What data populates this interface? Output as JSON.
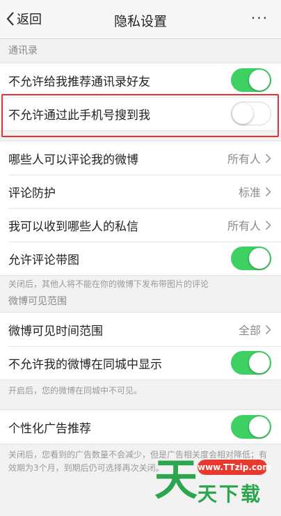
{
  "topbar": {
    "back_label": "返回",
    "title": "隐私设置",
    "more_label": "···"
  },
  "contacts": {
    "section_label": "通讯录",
    "items": [
      {
        "label": "不允许给我推荐通讯录好友",
        "toggle": "on"
      },
      {
        "label": "不允许通过此手机号搜到我",
        "toggle": "off"
      }
    ]
  },
  "comments": {
    "items": [
      {
        "label": "哪些人可以评论我的微博",
        "value": "所有人"
      },
      {
        "label": "评论防护",
        "value": "标准"
      },
      {
        "label": "我可以收到哪些人的私信",
        "value": "所有人"
      },
      {
        "label": "允许评论带图",
        "toggle": "on"
      }
    ],
    "note": "关闭后，其他人将不能在你的微博下发布带图片的评论"
  },
  "visibility": {
    "section_label": "微博可见范围",
    "items": [
      {
        "label": "微博可见时间范围",
        "value": "全部"
      },
      {
        "label": "不允许我的微博在同城中显示",
        "toggle": "on"
      }
    ],
    "note": "开启后，您的微博在同城中不可见。"
  },
  "ads": {
    "items": [
      {
        "label": "个性化广告推荐",
        "toggle": "on"
      }
    ],
    "note": "关闭后，您看到的广告数量不会减少，但是广告相关度会相对降低；有效期为3个月，到期后仍可选择再次关闭。"
  },
  "watermark": {
    "glyph": "天",
    "url": "www.TTzip.com",
    "text": "天下载"
  },
  "colors": {
    "toggle_on": "#3ed063",
    "highlight": "#e53030"
  }
}
